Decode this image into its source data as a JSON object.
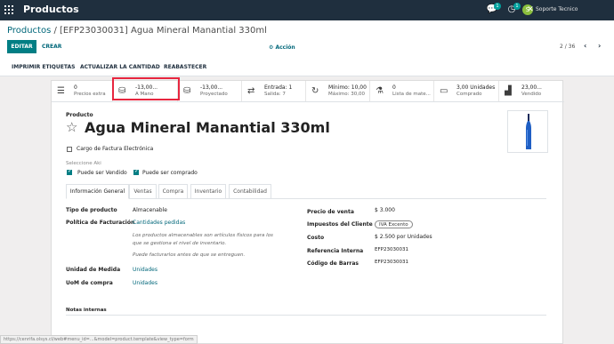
{
  "topbar": {
    "app_name": "Productos",
    "chat_badge": "1",
    "activity_badge": "1",
    "user_initial": "S",
    "user_name": "Soporte Tecnico"
  },
  "breadcrumb": {
    "parent": "Productos",
    "separator": " / ",
    "current": "[EFP23030031] Agua Mineral Manantial 330ml"
  },
  "buttons": {
    "edit": "EDITAR",
    "create": "CREAR",
    "action": "Acción"
  },
  "pager": {
    "value": "2 / 36",
    "prev": "‹",
    "next": "›"
  },
  "actions": [
    "IMPRIMIR ETIQUETAS",
    "ACTUALIZAR LA CANTIDAD",
    "REABASTECER"
  ],
  "smart_buttons": [
    {
      "icon": "list-icon",
      "value": "0",
      "label": "Precios extra"
    },
    {
      "icon": "cubes-icon",
      "value": "-13,00...",
      "label": "A Mano"
    },
    {
      "icon": "cubes-icon",
      "value": "-13,00...",
      "label": "Proyectado"
    },
    {
      "icon": "exchange-icon",
      "value": "Entrada: 1",
      "label": "Salida: 7"
    },
    {
      "icon": "refresh-icon",
      "value": "Mínimo: 10,00",
      "label": "Máximo: 30,00"
    },
    {
      "icon": "flask-icon",
      "value": "0",
      "label": "Lista de mate..."
    },
    {
      "icon": "credit-card-icon",
      "value": "3,00 Unidades",
      "label": "Comprado"
    },
    {
      "icon": "bar-chart-icon",
      "value": "23,00...",
      "label": "Vendido"
    }
  ],
  "product": {
    "label": "Producto",
    "name": "Agua Mineral Manantial 330ml",
    "cargo_factura": "Cargo de Factura Electrónica",
    "seleccione": "Seleccione Aki",
    "can_sell": "Puede ser Vendido",
    "can_buy": "Puede ser comprado"
  },
  "tabs": [
    "Información General",
    "Ventas",
    "Compra",
    "Inventario",
    "Contabilidad"
  ],
  "fields_left": {
    "tipo_label": "Tipo de producto",
    "tipo_value": "Almacenable",
    "politica_label": "Política de Facturación",
    "politica_value": "Cantidades pedidas",
    "help1": "Los productos almacenables son artículos físicos para los",
    "help2": "que se gestiona el nivel de inventario.",
    "help3": "Puede facturarlos antes de que se entreguen.",
    "uom_label": "Unidad de Medida",
    "uom_value": "Unidades",
    "uom_po_label": "UoM de compra",
    "uom_po_value": "Unidades"
  },
  "fields_right": {
    "precio_label": "Precio de venta",
    "precio_value": "$ 3.000",
    "impuestos_label": "Impuestos del Cliente",
    "impuestos_value": "IVA Excento",
    "costo_label": "Costo",
    "costo_value": "$ 2.500 por Unidades",
    "ref_label": "Referencia Interna",
    "ref_value": "EFP23030031",
    "barcode_label": "Código de Barras",
    "barcode_value": "EFP23030031"
  },
  "notes_label": "Notas internas",
  "status_url": "https://cenrifa.olsys.cl/web#menu_id=...&model=product.template&view_type=form"
}
